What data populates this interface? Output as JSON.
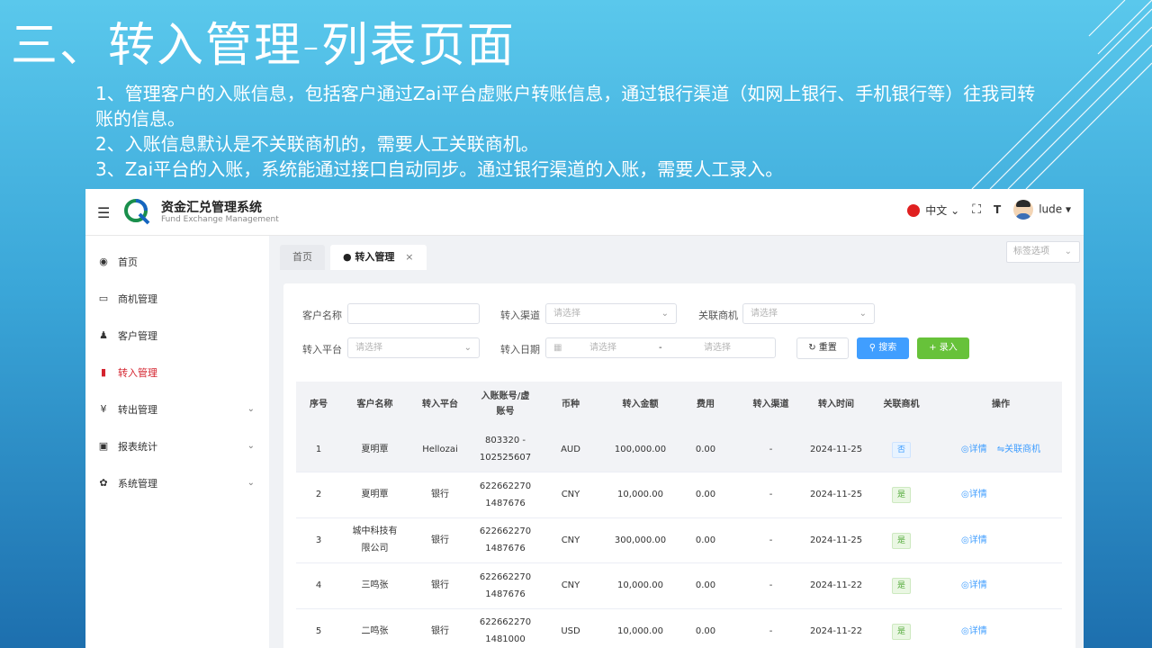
{
  "slide": {
    "title": "三、转入管理-列表页面",
    "notes": [
      "1、管理客户的入账信息，包括客户通过Zai平台虚账户转账信息，通过银行渠道（如网上银行、手机银行等）往我司转账的信息。",
      "2、入账信息默认是不关联商机的，需要人工关联商机。",
      "3、Zai平台的入账，系统能通过接口自动同步。通过银行渠道的入账，需要人工录入。"
    ]
  },
  "app": {
    "brand_title": "资金汇兑管理系统",
    "brand_subtitle": "Fund Exchange Management",
    "language": "中文",
    "username": "lude"
  },
  "sidebar": {
    "items": [
      {
        "label": "首页",
        "icon": "dashboard-icon"
      },
      {
        "label": "商机管理",
        "icon": "book-icon"
      },
      {
        "label": "客户管理",
        "icon": "users-icon"
      },
      {
        "label": "转入管理",
        "icon": "inbound-icon"
      },
      {
        "label": "转出管理",
        "icon": "yen-icon"
      },
      {
        "label": "报表统计",
        "icon": "monitor-icon"
      },
      {
        "label": "系统管理",
        "icon": "settings-icon"
      }
    ]
  },
  "tabs": {
    "home": "首页",
    "current": "● 转入管理",
    "tag_options": "标签选项"
  },
  "filters": {
    "customer_name_label": "客户名称",
    "channel_label": "转入渠道",
    "channel_placeholder": "请选择",
    "linked_label": "关联商机",
    "linked_placeholder": "请选择",
    "platform_label": "转入平台",
    "platform_placeholder": "请选择",
    "date_label": "转入日期",
    "date_start_placeholder": "请选择",
    "date_separator": "-",
    "date_end_placeholder": "请选择",
    "reset_label": "重置",
    "search_label": "搜索",
    "add_label": "录入"
  },
  "table": {
    "headers": [
      "序号",
      "客户名称",
      "转入平台",
      "入账账号/虚账号",
      "币种",
      "转入金额",
      "费用",
      "转入渠道",
      "转入时间",
      "关联商机",
      "操作"
    ],
    "rows": [
      {
        "no": "1",
        "customer": "夏明覃",
        "platform": "Hellozai",
        "account": "803320 - 102525607",
        "currency": "AUD",
        "amount": "100,000.00",
        "fee": "0.00",
        "channel": "-",
        "date": "2024-11-25",
        "linked": "否",
        "detail": "详情",
        "link_action": "关联商机"
      },
      {
        "no": "2",
        "customer": "夏明覃",
        "platform": "银行",
        "account": "622662270 1487676",
        "currency": "CNY",
        "amount": "10,000.00",
        "fee": "0.00",
        "channel": "-",
        "date": "2024-11-25",
        "linked": "是",
        "detail": "详情"
      },
      {
        "no": "3",
        "customer": "城中科技有限公司",
        "platform": "银行",
        "account": "622662270 1487676",
        "currency": "CNY",
        "amount": "300,000.00",
        "fee": "0.00",
        "channel": "-",
        "date": "2024-11-25",
        "linked": "是",
        "detail": "详情"
      },
      {
        "no": "4",
        "customer": "三鸣张",
        "platform": "银行",
        "account": "622662270 1487676",
        "currency": "CNY",
        "amount": "10,000.00",
        "fee": "0.00",
        "channel": "-",
        "date": "2024-11-22",
        "linked": "是",
        "detail": "详情"
      },
      {
        "no": "5",
        "customer": "二鸣张",
        "platform": "银行",
        "account": "622662270 1481000",
        "currency": "USD",
        "amount": "10,000.00",
        "fee": "0.00",
        "channel": "-",
        "date": "2024-11-22",
        "linked": "是",
        "detail": "详情"
      }
    ]
  }
}
